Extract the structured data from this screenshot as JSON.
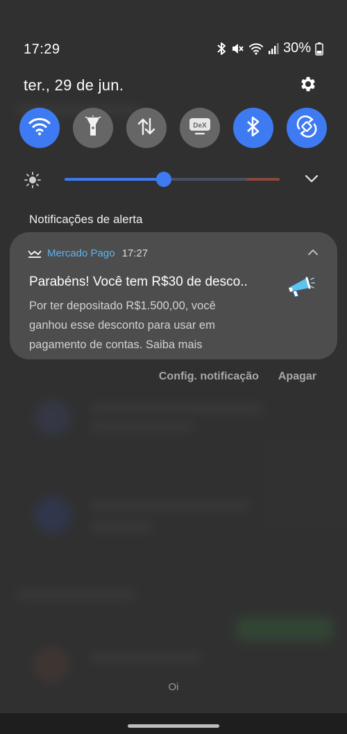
{
  "status_bar": {
    "time": "17:29",
    "battery": "30%",
    "icons": [
      "bluetooth-icon",
      "mute-icon",
      "wifi-icon",
      "signal-icon",
      "battery-icon"
    ]
  },
  "header": {
    "date": "ter., 29 de jun.",
    "settings_icon": "gear-icon"
  },
  "quick_settings": [
    {
      "icon": "wifi-icon",
      "state": "on"
    },
    {
      "icon": "flashlight-icon",
      "state": "off"
    },
    {
      "icon": "mobile-data-icon",
      "state": "off"
    },
    {
      "icon": "dex-icon",
      "label": "DeX",
      "state": "off"
    },
    {
      "icon": "bluetooth-icon",
      "state": "on"
    },
    {
      "icon": "auto-rotate-icon",
      "state": "on"
    }
  ],
  "brightness": {
    "level": 0.46
  },
  "colors": {
    "accent": "#3e7bf2",
    "app_name": "#5fb3f0",
    "card": "#4d4d4d"
  },
  "notifications": {
    "section_title": "Notificações de alerta",
    "items": [
      {
        "app_name": "Mercado Pago",
        "time": "17:27",
        "title": "Parabéns! Você tem R$30 de desco..",
        "body": "Por ter depositado R$1.500,00, você ganhou esse desconto para usar em pagamento de contas. Saiba mais"
      }
    ],
    "actions": {
      "settings": "Config. notificação",
      "clear": "Apagar"
    }
  },
  "bottom_label": "Oi"
}
